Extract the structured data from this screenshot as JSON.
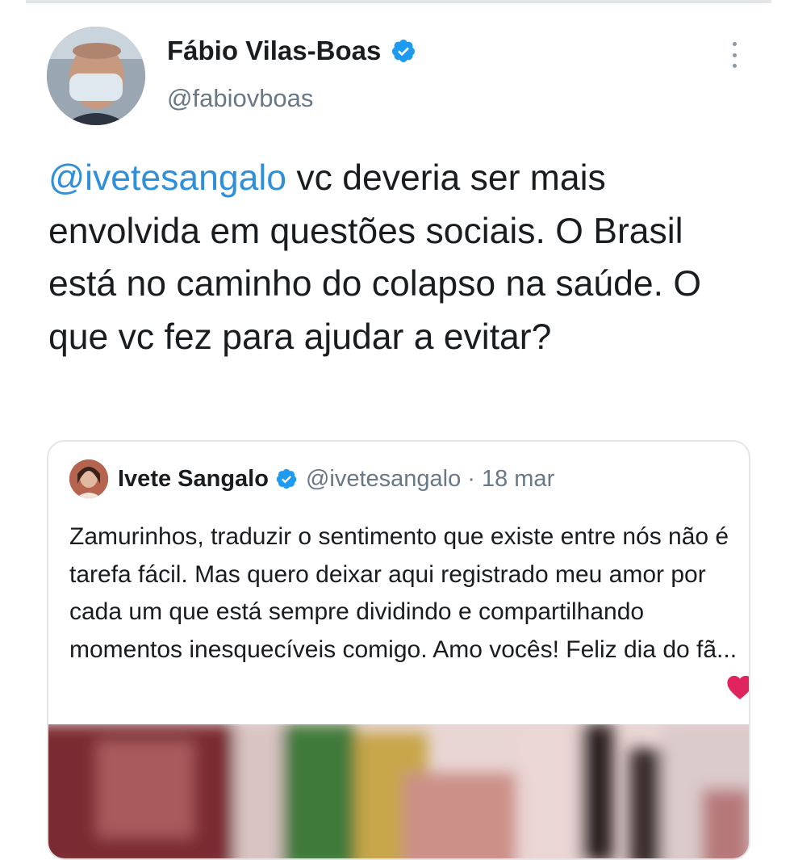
{
  "tweet": {
    "author_name": "Fábio Vilas-Boas",
    "author_handle": "@fabiovboas",
    "mention": "@ivetesangalo",
    "text": " vc deveria ser mais envolvida em questões sociais. O Brasil está no caminho do colapso na saúde. O que vc fez para ajudar a evitar?"
  },
  "quoted_tweet": {
    "author_name": "Ivete Sangalo",
    "author_handle": "@ivetesangalo",
    "date": "· 18 mar",
    "text": "Zamurinhos, traduzir o sentimento que existe entre nós não é tarefa fácil. Mas quero deixar aqui registrado meu amor por cada um que está sempre dividindo e compartilhando momentos inesquecíveis comigo. Amo vocês! Feliz dia do fã..."
  },
  "colors": {
    "mention": "#2f8fd8",
    "verified": "#1d9bf0",
    "heart": "#e0245e",
    "secondary_text": "#687886"
  },
  "icons": [
    "verified-badge-icon",
    "more-options-icon",
    "heart-emoji-icon"
  ]
}
